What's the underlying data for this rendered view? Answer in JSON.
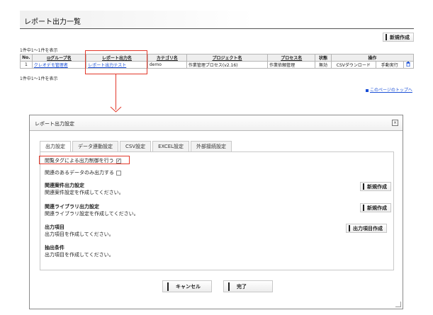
{
  "page": {
    "title": "レポート出力一覧"
  },
  "toolbar": {
    "new_label": "新規作成"
  },
  "list": {
    "count_top": "1件中1～1件を表示",
    "count_bottom": "1件中1～1件を表示",
    "columns": [
      {
        "label": "No."
      },
      {
        "label": "⊟グループ名"
      },
      {
        "label": "レポート出力名"
      },
      {
        "label": "カテゴリ名"
      },
      {
        "label": "プロジェクト名"
      },
      {
        "label": "プロセス名"
      },
      {
        "label": "状態"
      },
      {
        "label": "操作"
      }
    ],
    "rows": [
      {
        "no": "1",
        "group": "クレオデモ管理者",
        "report": "レポート出力テスト",
        "category": "demo",
        "project": "作業管理プロセス(v2.16)",
        "process": "作業依頼管理",
        "status": "無効",
        "action_csv": "CSVダウンロード",
        "action_manual": "手動実行"
      }
    ]
  },
  "top_link": "このページのトップへ",
  "modal": {
    "title": "レポート出力設定",
    "close": "×",
    "tabs": [
      {
        "label": "出力設定"
      },
      {
        "label": "データ連動設定"
      },
      {
        "label": "CSV設定"
      },
      {
        "label": "EXCEL設定"
      },
      {
        "label": "外部接続設定"
      }
    ],
    "options": {
      "browse_tag": {
        "label": "閲覧タグによる出力制御を行う",
        "checked": true
      },
      "related_only": {
        "label": "関連のあるデータのみ出力する",
        "checked": false
      }
    },
    "sections": {
      "related_case": {
        "title": "関連案件出力設定",
        "desc": "関連案件設定を作成してください。",
        "button": "新規作成"
      },
      "related_library": {
        "title": "関連ライブラリ出力設定",
        "desc": "関連ライブラリ設定を作成してください。",
        "button": "新規作成"
      },
      "output_items": {
        "title": "出力項目",
        "desc": "出力項目を作成してください。",
        "button": "出力項目作成"
      },
      "extract": {
        "title": "抽出条件",
        "desc": "出力項目を作成してください。"
      }
    },
    "buttons": {
      "cancel": "キャンセル",
      "done": "完了"
    }
  },
  "colors": {
    "link": "#1a4fd6",
    "highlight": "#e2382a"
  }
}
